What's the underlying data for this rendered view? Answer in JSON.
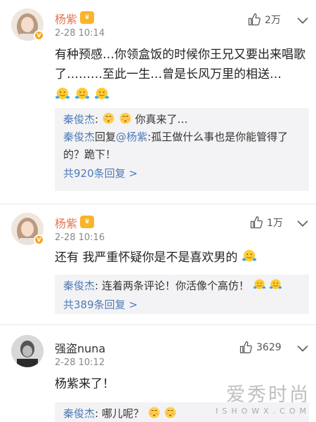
{
  "comments": [
    {
      "username": "杨紫",
      "time": "2-28 10:14",
      "like_count": "2万",
      "text": "有种预感…你领盒饭的时候你王兄又要出来唱歌了………至此一生…曾是长风万里的相送…",
      "replies": [
        {
          "user": "秦俊杰",
          "text": "你真来了…"
        },
        {
          "user": "秦俊杰",
          "reply_word": "回复",
          "mention": "@杨紫",
          "text": ":孤王做什么事也是你能管得了的？跪下！"
        }
      ],
      "more_replies": "共920条回复 >"
    },
    {
      "username": "杨紫",
      "time": "2-28 10:16",
      "like_count": "1万",
      "text": "还有 我严重怀疑你是不是喜欢男的",
      "replies": [
        {
          "user": "秦俊杰",
          "text": "连着两条评论！你活像个高仿！"
        }
      ],
      "more_replies": "共389条回复 >"
    },
    {
      "username": "强盗nuna",
      "time": "2-28 10:12",
      "like_count": "3629",
      "text": "杨紫来了！",
      "replies": [
        {
          "user": "秦俊杰",
          "text": "哪儿呢？"
        }
      ]
    }
  ],
  "watermark": {
    "cn": "爱秀时尚",
    "en": "ISHOWX.COM"
  },
  "icons": {
    "like": "thumbs-up-icon",
    "more": "chevron-down-icon",
    "verified": "v-badge-icon",
    "member": "crown-icon",
    "emoji_hug": "hug-emoji-icon",
    "emoji_shy": "shy-emoji-icon"
  },
  "colors": {
    "username": "#eb7350",
    "link": "#4e7bb6",
    "verified": "#f5a623"
  }
}
